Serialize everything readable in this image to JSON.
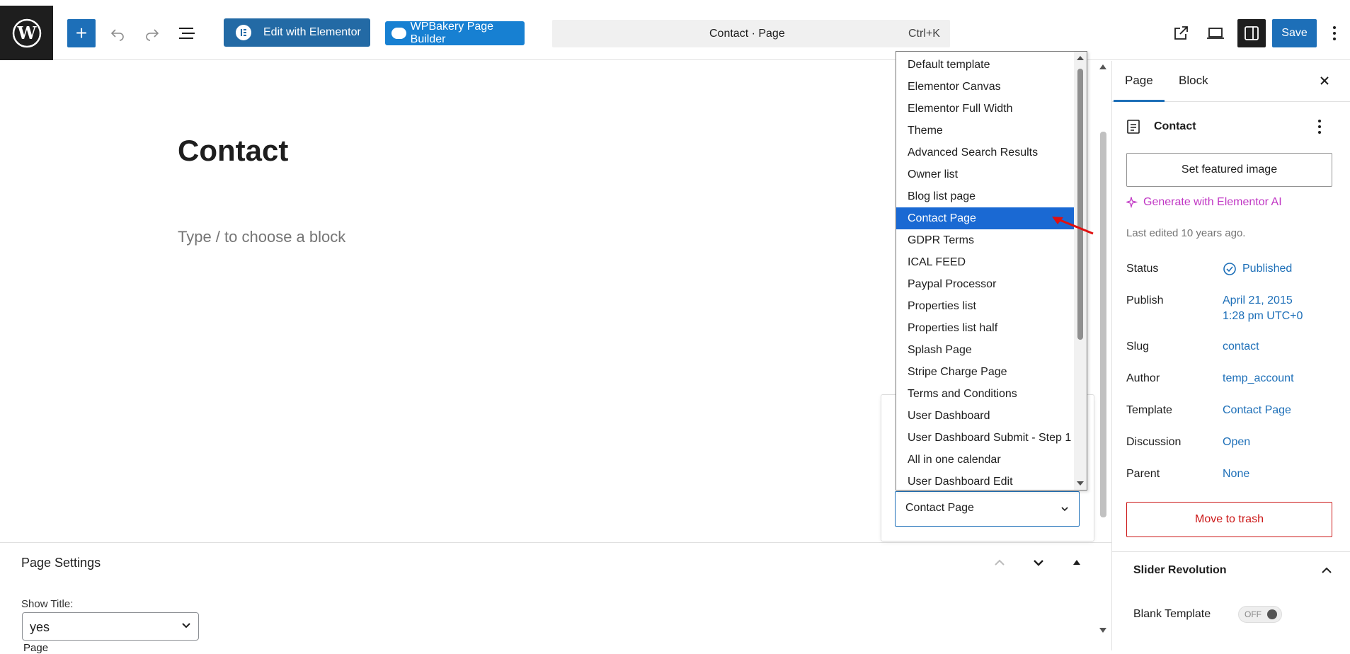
{
  "toolbar": {
    "elementor_label": "Edit with Elementor",
    "wpbakery_label": "WPBakery Page Builder",
    "command_title": "Contact · Page",
    "command_shortcut": "Ctrl+K",
    "save_label": "Save"
  },
  "editor": {
    "title": "Contact",
    "placeholder": "Type / to choose a block"
  },
  "page_settings": {
    "title": "Page Settings",
    "show_title_label": "Show Title:",
    "show_title_value": "yes",
    "next_label": "Page"
  },
  "template_dropdown": {
    "options": [
      "Default template",
      "Elementor Canvas",
      "Elementor Full Width",
      "Theme",
      "Advanced Search Results",
      "Owner list",
      "Blog list page",
      "Contact Page",
      "GDPR Terms",
      "ICAL FEED",
      "Paypal Processor",
      "Properties list",
      "Properties list half",
      "Splash Page",
      "Stripe Charge Page",
      "Terms and Conditions",
      "User Dashboard",
      "User Dashboard Submit - Step 1",
      "All in one calendar",
      "User Dashboard Edit"
    ],
    "selected_value": "Contact Page"
  },
  "sidebar": {
    "tab_page": "Page",
    "tab_block": "Block",
    "doc_title": "Contact",
    "featured_image": "Set featured image",
    "generate_ai": "Generate with Elementor AI",
    "last_edited": "Last edited 10 years ago.",
    "rows": {
      "status_label": "Status",
      "status_value": "Published",
      "publish_label": "Publish",
      "publish_date": "April 21, 2015",
      "publish_time": "1:28 pm UTC+0",
      "slug_label": "Slug",
      "slug_value": "contact",
      "author_label": "Author",
      "author_value": "temp_account",
      "template_label": "Template",
      "template_value": "Contact Page",
      "discussion_label": "Discussion",
      "discussion_value": "Open",
      "parent_label": "Parent",
      "parent_value": "None"
    },
    "trash": "Move to trash",
    "slider_title": "Slider Revolution",
    "blank_template_label": "Blank Template",
    "toggle_state": "OFF"
  }
}
